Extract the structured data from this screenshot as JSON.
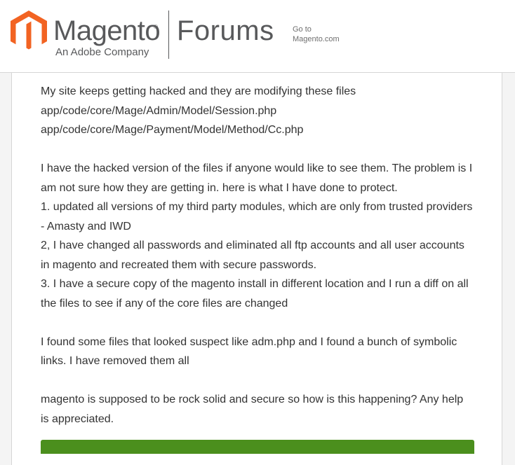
{
  "header": {
    "brand_name": "Magento",
    "brand_reg": "®",
    "brand_sub": "An Adobe Company",
    "section_title": "Forums",
    "goto_line1": "Go to",
    "goto_line2": "Magento.com",
    "logo_icon": "magento-logo-icon",
    "colors": {
      "logo_orange": "#f26322",
      "text_gray": "#58595b",
      "action_green": "#4b8f1d"
    }
  },
  "post": {
    "lines": {
      "l1": "My site keeps getting hacked and they are modifying these files",
      "l2": "app/code/core/Mage/Admin/Model/Session.php",
      "l3": "app/code/core/Mage/Payment/Model/Method/Cc.php",
      "l4": "I have the hacked version of the files if anyone would like to see them.  The problem is I",
      "l5": "am not sure how they are getting in.  here is what I have done to protect.",
      "l6": "1. updated all versions of my third party modules, which are only from trusted providers",
      "l7": "- Amasty and IWD",
      "l8": "2, I have changed all passwords and eliminated all ftp accounts and all user accounts",
      "l9": "in magento and recreated them with secure passwords.",
      "l10": "3. I have a secure copy of the magento install in different location and I run a diff on all",
      "l11": "the files to see if any of the core files are changed",
      "l12": "I found some files that looked suspect like adm.php and I found a bunch of symbolic",
      "l13": "links.   I have removed them all",
      "l14": "magento is supposed to be rock solid and secure so how is this happening?  Any help",
      "l15": "is appreciated."
    }
  }
}
